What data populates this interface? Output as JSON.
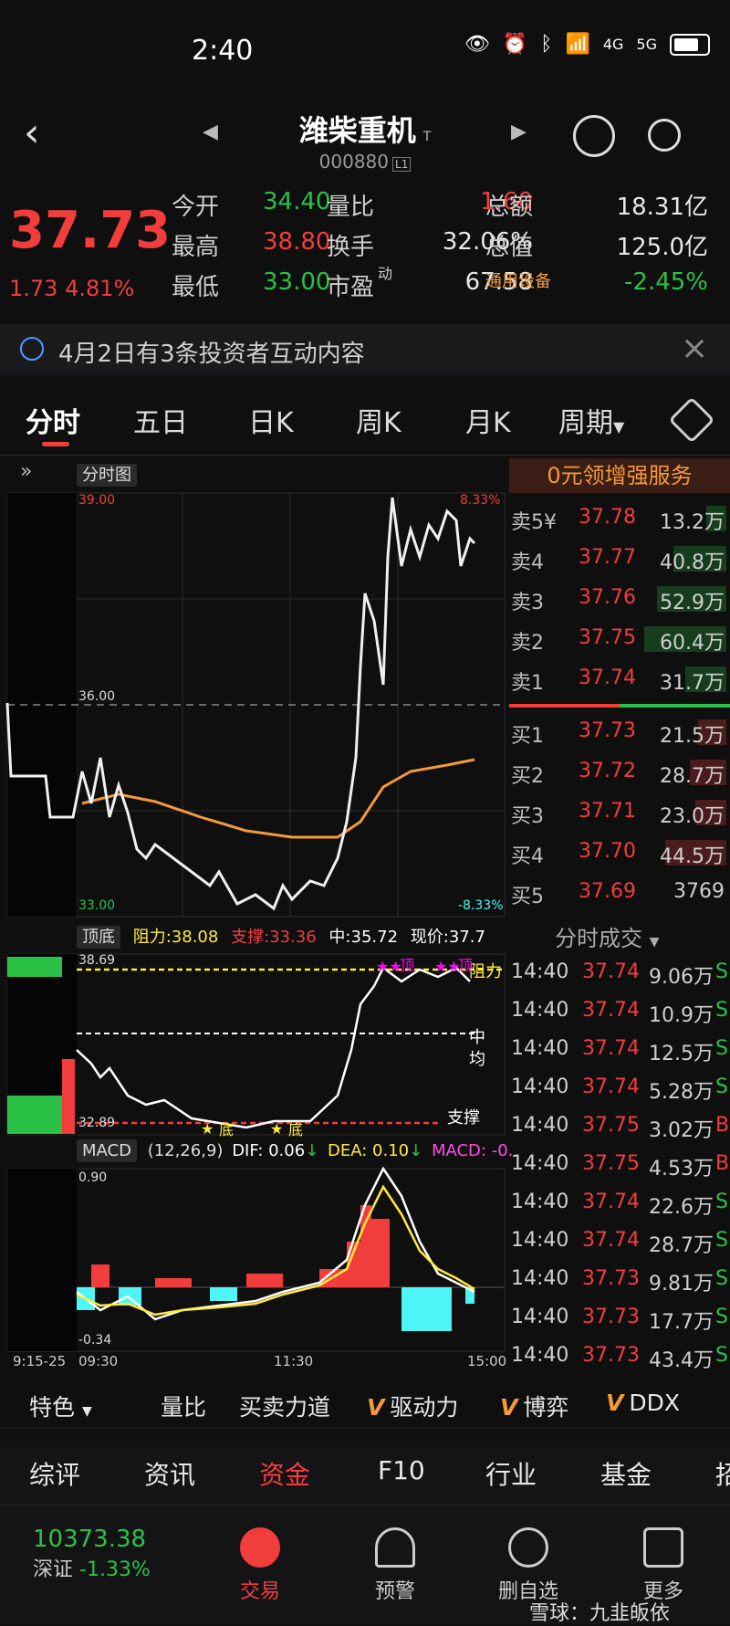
{
  "status": {
    "time": "2:40",
    "net1": "4G",
    "net2": "5G"
  },
  "header": {
    "name": "潍柴重机",
    "tag": "T",
    "code": "000880",
    "level": "L1"
  },
  "quote": {
    "price": "37.73",
    "change": "1.73",
    "change_pct": "4.81%",
    "rows": [
      {
        "l1": "今开",
        "v1": "34.40",
        "c1": "#2bc146",
        "l2": "量比",
        "v2": "1.60",
        "c2": "#f23d3d",
        "l3": "总额",
        "v3": "18.31亿",
        "c3": "#e8e8e8"
      },
      {
        "l1": "最高",
        "v1": "38.80",
        "c1": "#f23d3d",
        "l2": "换手",
        "v2": "32.06%",
        "c2": "#e8e8e8",
        "l3": "总值",
        "v3": "125.0亿",
        "c3": "#e8e8e8"
      },
      {
        "l1": "最低",
        "v1": "33.00",
        "c1": "#2bc146",
        "l2": "市盈",
        "sup": "动",
        "v2": "67.58",
        "c2": "#e8e8e8",
        "l3": "通用设备",
        "v3": "-2.45%",
        "c3": "#2bc146"
      }
    ]
  },
  "notice": {
    "text": "4月2日有3条投资者互动内容"
  },
  "tabs": [
    "分时",
    "五日",
    "日K",
    "周K",
    "月K",
    "周期"
  ],
  "chart": {
    "type_label": "分时图",
    "top_price": "39.00",
    "mid_price": "36.00",
    "bot_price": "33.00",
    "top_pct": "8.33%",
    "bot_pct": "-8.33%",
    "ind_label": "顶底",
    "resist": "阻力:38.08",
    "support": "支撑:33.36",
    "mid": "中:35.72",
    "now": "现价:37.7",
    "ind_top": "38.69",
    "ind_bot": "32.89",
    "label_resist": "阻力",
    "label_mid": "中",
    "label_avg": "均",
    "label_support": "支撑",
    "label_top": "顶",
    "label_bottom": "底",
    "macd_label": "MACD",
    "macd_params": "(12,26,9)",
    "dif": "DIF: 0.06",
    "dea": "DEA: 0.10",
    "macd": "MACD: -0.",
    "macd_top": "0.90",
    "macd_bot": "-0.34",
    "t0": "9:15-25",
    "t1": "09:30",
    "t2": "11:30",
    "t3": "15:00"
  },
  "book": {
    "promo": "0元领增强服务",
    "sells": [
      {
        "label": "卖5¥",
        "price": "37.78",
        "vol": "13.2万",
        "bar": 0.25
      },
      {
        "label": "卖4",
        "price": "37.77",
        "vol": "40.8万",
        "bar": 0.65
      },
      {
        "label": "卖3",
        "price": "37.76",
        "vol": "52.9万",
        "bar": 0.85
      },
      {
        "label": "卖2",
        "price": "37.75",
        "vol": "60.4万",
        "bar": 1.0
      },
      {
        "label": "卖1",
        "price": "37.74",
        "vol": "31.7万",
        "bar": 0.5
      }
    ],
    "buys": [
      {
        "label": "买1",
        "price": "37.73",
        "vol": "21.5万",
        "bar": 0.35
      },
      {
        "label": "买2",
        "price": "37.72",
        "vol": "28.7万",
        "bar": 0.45
      },
      {
        "label": "买3",
        "price": "37.71",
        "vol": "23.0万",
        "bar": 0.38
      },
      {
        "label": "买4",
        "price": "37.70",
        "vol": "44.5万",
        "bar": 0.75
      },
      {
        "label": "买5",
        "price": "37.69",
        "vol": "3769",
        "bar": 0.0
      }
    ],
    "trades_title": "分时成交",
    "trades": [
      {
        "t": "14:40",
        "p": "37.74",
        "v": "9.06万",
        "s": "S"
      },
      {
        "t": "14:40",
        "p": "37.74",
        "v": "10.9万",
        "s": "S"
      },
      {
        "t": "14:40",
        "p": "37.74",
        "v": "12.5万",
        "s": "S"
      },
      {
        "t": "14:40",
        "p": "37.74",
        "v": "5.28万",
        "s": "S"
      },
      {
        "t": "14:40",
        "p": "37.75",
        "v": "3.02万",
        "s": "B"
      },
      {
        "t": "14:40",
        "p": "37.75",
        "v": "4.53万",
        "s": "B"
      },
      {
        "t": "14:40",
        "p": "37.74",
        "v": "22.6万",
        "s": "S"
      },
      {
        "t": "14:40",
        "p": "37.74",
        "v": "28.7万",
        "s": "S"
      },
      {
        "t": "14:40",
        "p": "37.73",
        "v": "9.81万",
        "s": "S"
      },
      {
        "t": "14:40",
        "p": "37.73",
        "v": "17.7万",
        "s": "S"
      },
      {
        "t": "14:40",
        "p": "37.73",
        "v": "43.4万",
        "s": "S"
      }
    ]
  },
  "indicators": {
    "feature": "特色",
    "items": [
      "量比",
      "买卖力道",
      "驱动力",
      "博弈",
      "DDX"
    ],
    "v": "V"
  },
  "bottom_tabs": [
    "综评",
    "资讯",
    "资金",
    "F10",
    "行业",
    "基金",
    "招"
  ],
  "nav": {
    "index_value": "10373.38",
    "index_name": "深证",
    "index_chg": "-1.33%",
    "items": [
      "交易",
      "预警",
      "删自选",
      "更多"
    ],
    "watermark": "雪球：九韭皈依"
  }
}
